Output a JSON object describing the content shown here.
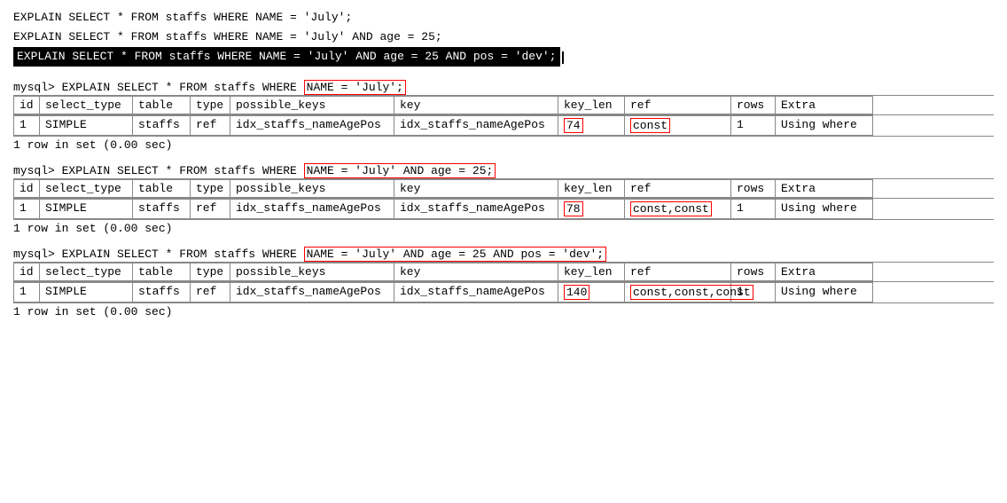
{
  "editor": {
    "lines": [
      {
        "text": "EXPLAIN SELECT * FROM staffs WHERE NAME = 'July';",
        "highlighted": false
      },
      {
        "text": "EXPLAIN SELECT * FROM staffs WHERE NAME = 'July' AND age = 25;",
        "highlighted": false
      },
      {
        "text": "EXPLAIN SELECT * FROM staffs WHERE NAME = 'July' AND age = 25 AND pos = 'dev';",
        "highlighted": true
      }
    ]
  },
  "results": [
    {
      "prompt": "mysql> EXPLAIN SELECT * FROM staffs WHERE ",
      "highlighted_condition": "NAME = 'July';",
      "headers": [
        "id",
        "select_type",
        "table",
        "type",
        "possible_keys",
        "key",
        "key_len",
        "ref",
        "rows",
        "Extra"
      ],
      "rows": [
        [
          "1",
          "SIMPLE",
          "staffs",
          "ref",
          "idx_staffs_nameAgePos",
          "idx_staffs_nameAgePos",
          "74",
          "const",
          "1",
          "Using where"
        ]
      ],
      "row_count": "1 row in set (0.00 sec)",
      "keylen_highlight": "74",
      "ref_highlight": "const"
    },
    {
      "prompt": "mysql> EXPLAIN SELECT * FROM staffs WHERE ",
      "highlighted_condition": "NAME = 'July' AND age = 25;",
      "headers": [
        "id",
        "select_type",
        "table",
        "type",
        "possible_keys",
        "key",
        "key_len",
        "ref",
        "rows",
        "Extra"
      ],
      "rows": [
        [
          "1",
          "SIMPLE",
          "staffs",
          "ref",
          "idx_staffs_nameAgePos",
          "idx_staffs_nameAgePos",
          "78",
          "const,const",
          "1",
          "Using where"
        ]
      ],
      "row_count": "1 row in set (0.00 sec)",
      "keylen_highlight": "78",
      "ref_highlight": "const,const"
    },
    {
      "prompt": "mysql> EXPLAIN SELECT * FROM staffs WHERE ",
      "highlighted_condition": "NAME = 'July' AND age = 25 AND pos = 'dev';",
      "headers": [
        "id",
        "select_type",
        "table",
        "type",
        "possible_keys",
        "key",
        "key_len",
        "ref",
        "rows",
        "Extra"
      ],
      "rows": [
        [
          "1",
          "SIMPLE",
          "staffs",
          "ref",
          "idx_staffs_nameAgePos",
          "idx_staffs_nameAgePos",
          "140",
          "const,const,const",
          "1",
          "Using where"
        ]
      ],
      "row_count": "1 row in set (0.00 sec)",
      "keylen_highlight": "140",
      "ref_highlight": "const,const,const"
    }
  ]
}
